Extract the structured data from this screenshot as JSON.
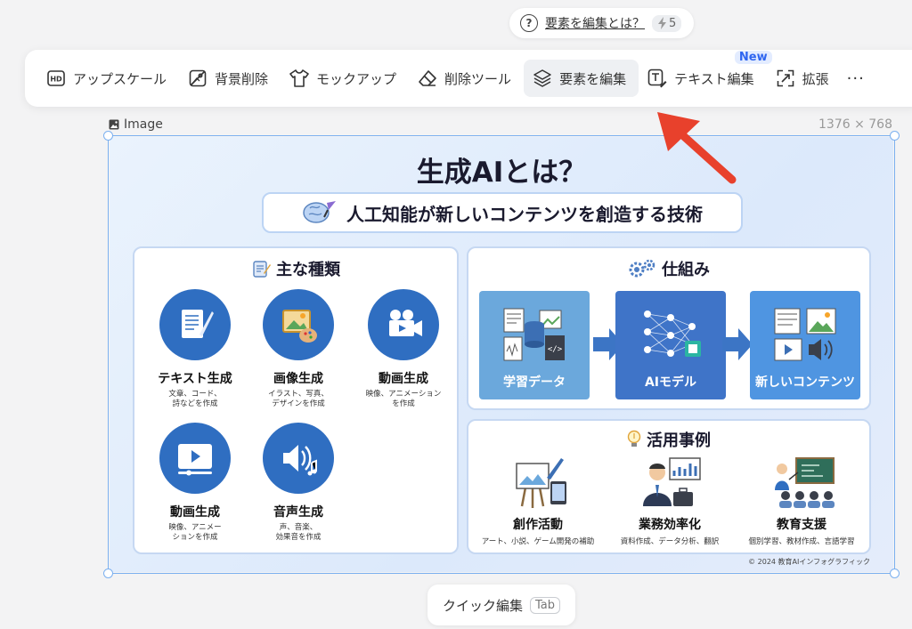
{
  "hint": {
    "text": "要素を編集とは？",
    "credit_icon": "bolt-icon",
    "credit_value": "5"
  },
  "toolbar": {
    "items": [
      {
        "label": "アップスケール",
        "icon": "hd-icon"
      },
      {
        "label": "背景削除",
        "icon": "remove-bg-icon"
      },
      {
        "label": "モックアップ",
        "icon": "tshirt-icon"
      },
      {
        "label": "削除ツール",
        "icon": "eraser-icon"
      },
      {
        "label": "要素を編集",
        "icon": "layers-icon",
        "active": true
      },
      {
        "label": "テキスト編集",
        "icon": "text-edit-icon",
        "badge": "New"
      },
      {
        "label": "拡張",
        "icon": "expand-icon"
      }
    ],
    "more": "···"
  },
  "image": {
    "label": "Image",
    "dimensions": "1376 × 768"
  },
  "infographic": {
    "title": "生成AIとは？",
    "subtitle": "人工知能が新しいコンテンツを創造する技術",
    "types_panel": {
      "heading": "主な種類",
      "items": [
        {
          "title": "テキスト生成",
          "desc": "文章、コード、\n詩などを作成"
        },
        {
          "title": "画像生成",
          "desc": "イラスト、写真、\nデザインを作成"
        },
        {
          "title": "動画生成",
          "desc": "映像、アニメーション\nを作成"
        },
        {
          "title": "動画生成",
          "desc": "映像、アニメー\nションを作成"
        },
        {
          "title": "音声生成",
          "desc": "声、音楽、\n効果音を作成"
        }
      ]
    },
    "mechanism_panel": {
      "heading": "仕組み",
      "steps": [
        "学習データ",
        "AIモデル",
        "新しいコンテンツ"
      ]
    },
    "cases_panel": {
      "heading": "活用事例",
      "items": [
        {
          "title": "創作活動",
          "desc": "アート、小説、ゲーム開発の補助"
        },
        {
          "title": "業務効率化",
          "desc": "資料作成、データ分析、翻訳"
        },
        {
          "title": "教育支援",
          "desc": "個別学習、教材作成、言語学習"
        }
      ]
    },
    "copyright": "© 2024 教育AIインフォグラフィック"
  },
  "quick_edit": {
    "label": "クイック編集",
    "key": "Tab"
  },
  "colors": {
    "accent": "#2f6ec1",
    "selection": "#7bb0f0",
    "arrow": "#e8412c",
    "badge": "#2f66f0"
  }
}
